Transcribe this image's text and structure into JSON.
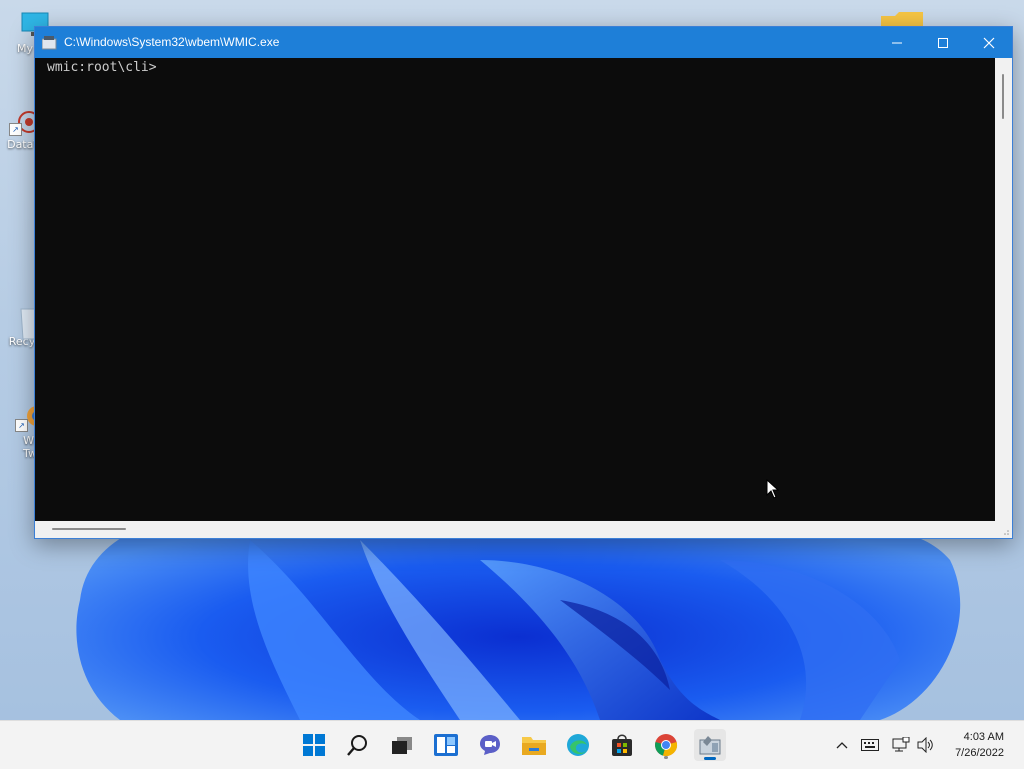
{
  "window": {
    "title": "C:\\Windows\\System32\\wbem\\WMIC.exe",
    "minimize_icon": "minimize-icon",
    "maximize_icon": "maximize-icon",
    "close_icon": "close-icon"
  },
  "console": {
    "lines": [
      "wmic:root\\cli>"
    ]
  },
  "desktop": {
    "icons": [
      {
        "label": "My Co",
        "icon": "monitor-icon"
      },
      {
        "label": "DataV",
        "icon": "datav-icon"
      },
      {
        "label": "Recy",
        "icon": "recycle-bin-icon"
      },
      {
        "label": "Wi",
        "label2": "Tw",
        "icon": "app-shortcut-icon"
      },
      {
        "label": "",
        "icon": "folder-icon"
      }
    ]
  },
  "taskbar": {
    "items": [
      {
        "name": "start",
        "icon": "windows-logo-icon"
      },
      {
        "name": "search",
        "icon": "search-icon"
      },
      {
        "name": "task-view",
        "icon": "task-view-icon"
      },
      {
        "name": "widgets",
        "icon": "widgets-icon"
      },
      {
        "name": "chat",
        "icon": "chat-icon"
      },
      {
        "name": "file-explorer",
        "icon": "folder-icon"
      },
      {
        "name": "edge",
        "icon": "edge-icon"
      },
      {
        "name": "store",
        "icon": "store-icon"
      },
      {
        "name": "chrome",
        "icon": "chrome-icon"
      },
      {
        "name": "wmic",
        "icon": "wmic-icon"
      }
    ],
    "tray": {
      "chevron_icon": "chevron-up-icon",
      "keyboard_icon": "keyboard-icon",
      "network_icon": "network-icon",
      "volume_icon": "volume-icon"
    },
    "time": "4:03 AM",
    "date": "7/26/2022"
  },
  "colors": {
    "titlebar": "#1e7fd8",
    "console_bg": "#0c0c0c",
    "console_text": "#cccccc",
    "accent": "#0067c0"
  }
}
